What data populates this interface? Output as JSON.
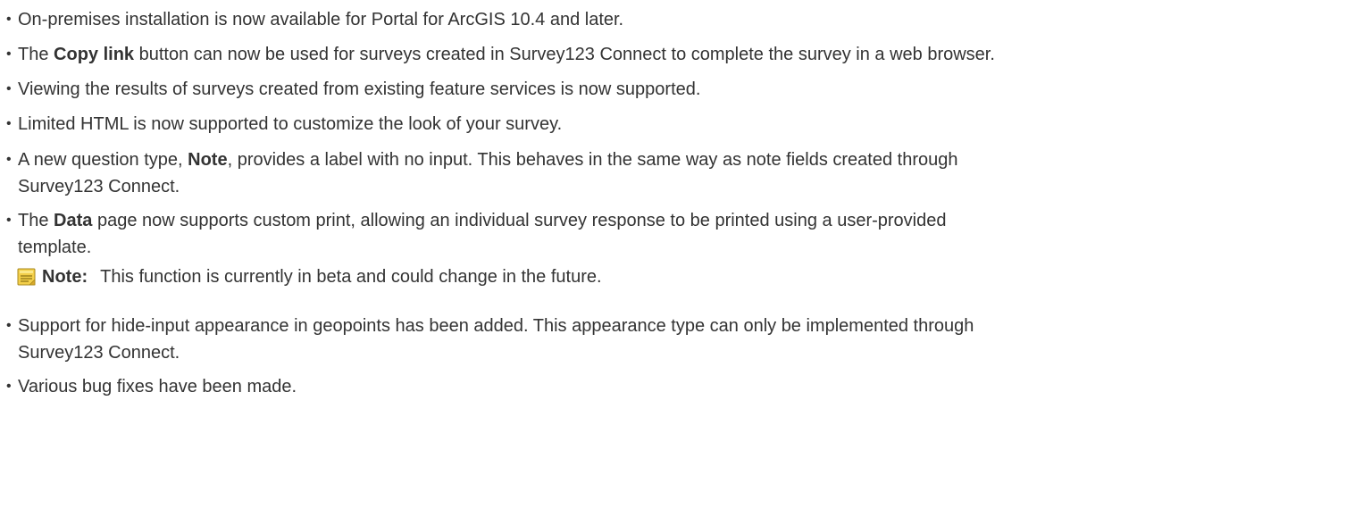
{
  "items": [
    {
      "parts": [
        {
          "t": "On-premises installation is now available for Portal for ArcGIS 10.4 and later."
        }
      ]
    },
    {
      "parts": [
        {
          "t": "The "
        },
        {
          "t": "Copy link",
          "b": true
        },
        {
          "t": " button can now be used for surveys created in Survey123 Connect to complete the survey in a web browser."
        }
      ]
    },
    {
      "parts": [
        {
          "t": "Viewing the results of surveys created from existing feature services is now supported."
        }
      ]
    },
    {
      "parts": [
        {
          "t": "Limited HTML is now supported to customize the look of your survey."
        }
      ]
    },
    {
      "parts": [
        {
          "t": "A new question type, "
        },
        {
          "t": "Note",
          "b": true
        },
        {
          "t": ", provides a label with no input. This behaves in the same way as note fields created through"
        }
      ],
      "line2": "Survey123 Connect."
    },
    {
      "parts": [
        {
          "t": "The "
        },
        {
          "t": "Data",
          "b": true
        },
        {
          "t": " page now supports custom print, allowing an individual survey response to be printed using a user-provided"
        }
      ],
      "line2": "template."
    },
    {
      "parts": [
        {
          "t": "Support for hide-input appearance in geopoints has been added. This appearance type can only be implemented through"
        }
      ],
      "line2": "Survey123 Connect."
    },
    {
      "parts": [
        {
          "t": "Various bug fixes have been made."
        }
      ]
    }
  ],
  "note": {
    "label": "Note:",
    "text": "This function is currently in beta and could change in the future.",
    "icon": "note-icon"
  }
}
